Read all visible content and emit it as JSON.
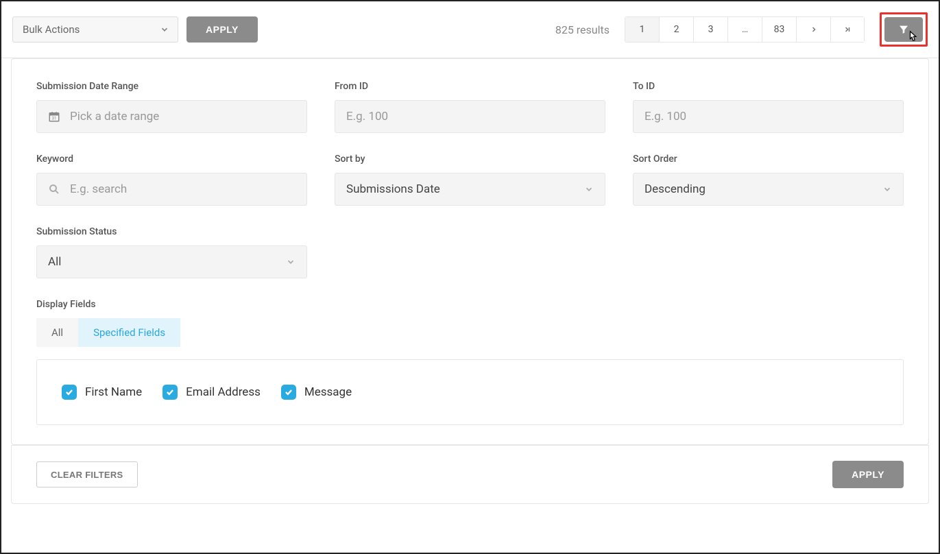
{
  "toolbar": {
    "bulk_actions_label": "Bulk Actions",
    "apply_label": "APPLY",
    "results_text": "825 results",
    "pages": [
      "1",
      "2",
      "3",
      "…",
      "83"
    ]
  },
  "filters": {
    "date_range": {
      "label": "Submission Date Range",
      "placeholder": "Pick a date range"
    },
    "from_id": {
      "label": "From ID",
      "placeholder": "E.g. 100"
    },
    "to_id": {
      "label": "To ID",
      "placeholder": "E.g. 100"
    },
    "keyword": {
      "label": "Keyword",
      "placeholder": "E.g. search"
    },
    "sort_by": {
      "label": "Sort by",
      "value": "Submissions Date"
    },
    "sort_order": {
      "label": "Sort Order",
      "value": "Descending"
    },
    "status": {
      "label": "Submission Status",
      "value": "All"
    },
    "display_fields": {
      "label": "Display Fields",
      "tabs": {
        "all": "All",
        "specified": "Specified Fields"
      },
      "checks": [
        "First Name",
        "Email Address",
        "Message"
      ]
    }
  },
  "footer": {
    "clear_label": "CLEAR FILTERS",
    "apply_label": "APPLY"
  }
}
